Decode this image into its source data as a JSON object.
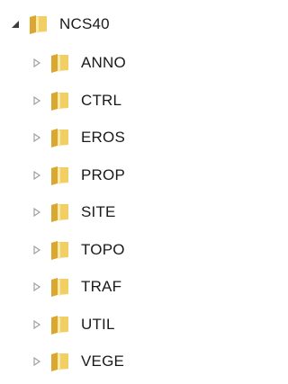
{
  "tree": {
    "root": {
      "label": "NCS40",
      "expanded": true,
      "icon": "folder-icon"
    },
    "children": [
      {
        "label": "ANNO",
        "expanded": false,
        "icon": "folder-icon"
      },
      {
        "label": "CTRL",
        "expanded": false,
        "icon": "folder-icon"
      },
      {
        "label": "EROS",
        "expanded": false,
        "icon": "folder-icon"
      },
      {
        "label": "PROP",
        "expanded": false,
        "icon": "folder-icon"
      },
      {
        "label": "SITE",
        "expanded": false,
        "icon": "folder-icon"
      },
      {
        "label": "TOPO",
        "expanded": false,
        "icon": "folder-icon"
      },
      {
        "label": "TRAF",
        "expanded": false,
        "icon": "folder-icon"
      },
      {
        "label": "UTIL",
        "expanded": false,
        "icon": "folder-icon"
      },
      {
        "label": "VEGE",
        "expanded": false,
        "icon": "folder-icon"
      }
    ],
    "colors": {
      "folder_light": "#fbe9a6",
      "folder_mid": "#f2cf63",
      "folder_dark": "#d9a833",
      "arrow_collapsed": "#a0a0a0",
      "arrow_expanded": "#3c3c3c"
    }
  }
}
